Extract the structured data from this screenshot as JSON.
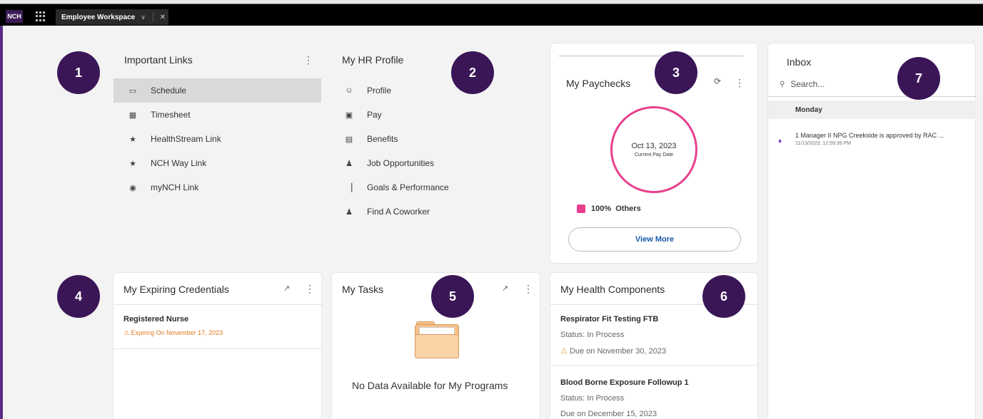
{
  "app": {
    "brand": "NCH",
    "tab_title": "Employee Workspace"
  },
  "badges": [
    "1",
    "2",
    "3",
    "4",
    "5",
    "6",
    "7"
  ],
  "important_links": {
    "title": "Important Links",
    "items": [
      {
        "label": "Schedule",
        "icon": "calendar-icon"
      },
      {
        "label": "Timesheet",
        "icon": "timesheet-icon"
      },
      {
        "label": "HealthStream Link",
        "icon": "link-icon"
      },
      {
        "label": "NCH Way Link",
        "icon": "star-icon"
      },
      {
        "label": "myNCH Link",
        "icon": "globe-icon"
      }
    ]
  },
  "hr_profile": {
    "title": "My HR Profile",
    "items": [
      {
        "label": "Profile",
        "icon": "user-circle-icon"
      },
      {
        "label": "Pay",
        "icon": "money-icon"
      },
      {
        "label": "Benefits",
        "icon": "briefcase-icon"
      },
      {
        "label": "Job Opportunities",
        "icon": "person-icon"
      },
      {
        "label": "Goals & Performance",
        "icon": "chart-icon"
      },
      {
        "label": "Find A Coworker",
        "icon": "people-icon"
      }
    ]
  },
  "paychecks": {
    "title": "My Paychecks",
    "date": "Oct 13, 2023",
    "date_caption": "Current Pay Date",
    "legend_label": "100%  Others",
    "legend_color": "#e8408e",
    "view_more": "View More"
  },
  "inbox": {
    "title": "Inbox",
    "search_placeholder": "Search...",
    "day": "Monday",
    "messages": [
      {
        "text": "1 Manager II NPG Creekside is approved by RAC ...",
        "time": "11/13/2023, 12:59:39 PM"
      }
    ]
  },
  "credentials": {
    "title": "My Expiring Credentials",
    "items": [
      {
        "name": "Registered Nurse",
        "status": "Expiring On November 17, 2023"
      }
    ]
  },
  "tasks": {
    "title": "My Tasks",
    "empty": "No Data Available for My Programs"
  },
  "health": {
    "title": "My Health Components",
    "items": [
      {
        "name": "Respirator Fit Testing FTB",
        "status": "Status: In Process",
        "due": "Due on November 30, 2023"
      },
      {
        "name": "Blood Borne Exposure Followup 1",
        "status": "Status: In Process",
        "due": "Due on December 15, 2023"
      }
    ]
  },
  "colors": {
    "badge": "#3a1657",
    "accent": "#e8408e",
    "link": "#1b5aa8",
    "warning": "#e07b1f"
  }
}
